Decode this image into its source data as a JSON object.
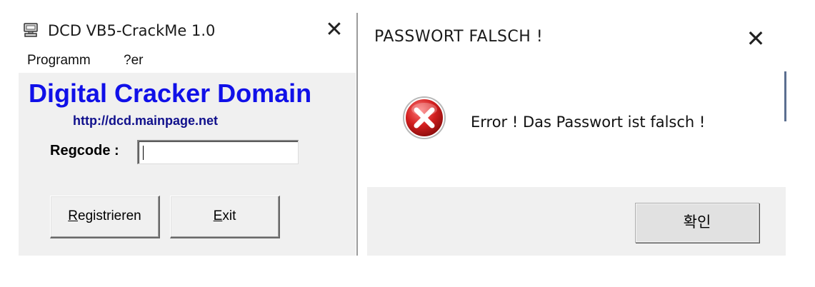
{
  "left_window": {
    "title": "DCD VB5-CrackMe 1.0",
    "icon": "computer-icon",
    "close_glyph": "✕",
    "menu": [
      "Programm",
      "?er"
    ],
    "brand": "Digital Cracker Domain",
    "url": "http://dcd.mainpage.net",
    "regcode_label": "Regcode :",
    "regcode_value": "",
    "buttons": {
      "register": {
        "mnemonic": "R",
        "rest": "egistrieren"
      },
      "exit": {
        "mnemonic": "E",
        "rest": "xit"
      }
    },
    "colors": {
      "brand": "#1010e8",
      "url": "#10108c",
      "client_bg": "#f0f0f0"
    }
  },
  "right_window": {
    "title": "PASSWORT FALSCH !",
    "close_glyph": "✕",
    "icon": "error-icon",
    "message": "Error ! Das Passwort ist falsch !",
    "ok_label": "확인",
    "colors": {
      "error_red": "#d21f1f",
      "footer_bg": "#f0f0f0"
    }
  }
}
